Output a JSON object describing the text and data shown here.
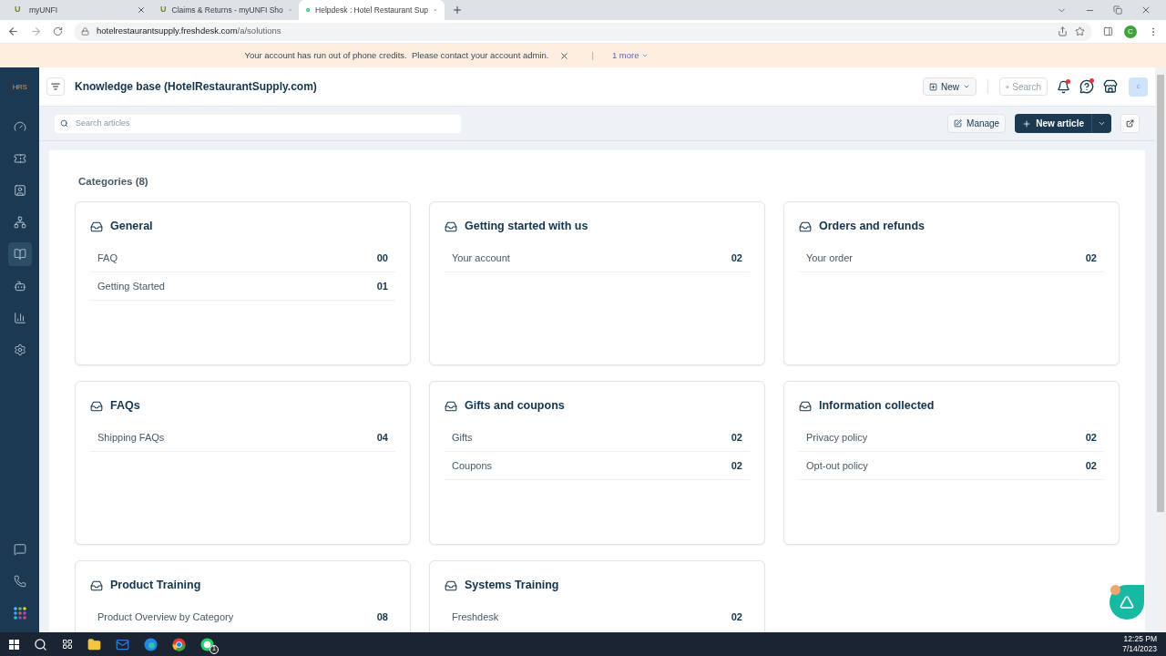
{
  "browser": {
    "tabs": [
      {
        "title": "myUNFI",
        "favicon": "U",
        "selected": false
      },
      {
        "title": "Claims & Returns - myUNFI Sho",
        "favicon": "U",
        "selected": false
      },
      {
        "title": "Helpdesk : Hotel Restaurant Sup",
        "selected": true
      }
    ],
    "url_host": "hotelrestaurantsupply.freshdesk.com",
    "url_path": "/a/solutions",
    "profile": "C"
  },
  "banner": {
    "message": "Your account has run out of phone credits.  Please contact your account admin.",
    "separator": "|",
    "more": "1 more"
  },
  "sidebar": {
    "logo": "HRS",
    "items": [
      {
        "selected": false
      },
      {
        "selected": false
      },
      {
        "selected": false
      },
      {
        "selected": false
      },
      {
        "selected": true
      },
      {
        "selected": false
      },
      {
        "selected": false
      },
      {
        "selected": false
      }
    ],
    "bottom_items": [
      {
        "selected": false
      },
      {
        "selected": false
      },
      {
        "selected": false
      }
    ]
  },
  "header": {
    "title": "Knowledge base (HotelRestaurantSupply.com)",
    "new_button": "New",
    "search": "Search",
    "avatar": "c",
    "bell_dot": true,
    "help_dot": true
  },
  "toolbar": {
    "search_placeholder": "Search articles",
    "manage": "Manage",
    "new_article": "New article"
  },
  "categories": {
    "heading": "Categories (8)",
    "items": [
      {
        "title": "General",
        "folders": [
          {
            "name": "FAQ",
            "count": "00"
          },
          {
            "name": "Getting Started",
            "count": "01"
          }
        ]
      },
      {
        "title": "Getting started with us",
        "folders": [
          {
            "name": "Your account",
            "count": "02"
          }
        ]
      },
      {
        "title": "Orders and refunds",
        "folders": [
          {
            "name": "Your order",
            "count": "02"
          }
        ]
      },
      {
        "title": "FAQs",
        "folders": [
          {
            "name": "Shipping FAQs",
            "count": "04"
          }
        ]
      },
      {
        "title": "Gifts and coupons",
        "folders": [
          {
            "name": "Gifts",
            "count": "02"
          },
          {
            "name": "Coupons",
            "count": "02"
          }
        ]
      },
      {
        "title": "Information collected",
        "folders": [
          {
            "name": "Privacy policy",
            "count": "02"
          },
          {
            "name": "Opt-out policy",
            "count": "02"
          }
        ]
      },
      {
        "title": "Product Training",
        "folders": [
          {
            "name": "Product Overview by Category",
            "count": "08"
          }
        ]
      },
      {
        "title": "Systems Training",
        "folders": [
          {
            "name": "Freshdesk",
            "count": "02"
          }
        ]
      }
    ]
  },
  "taskbar": {
    "whatsapp_badge": "1",
    "time": "12:25 PM",
    "date": "7/14/2023"
  }
}
